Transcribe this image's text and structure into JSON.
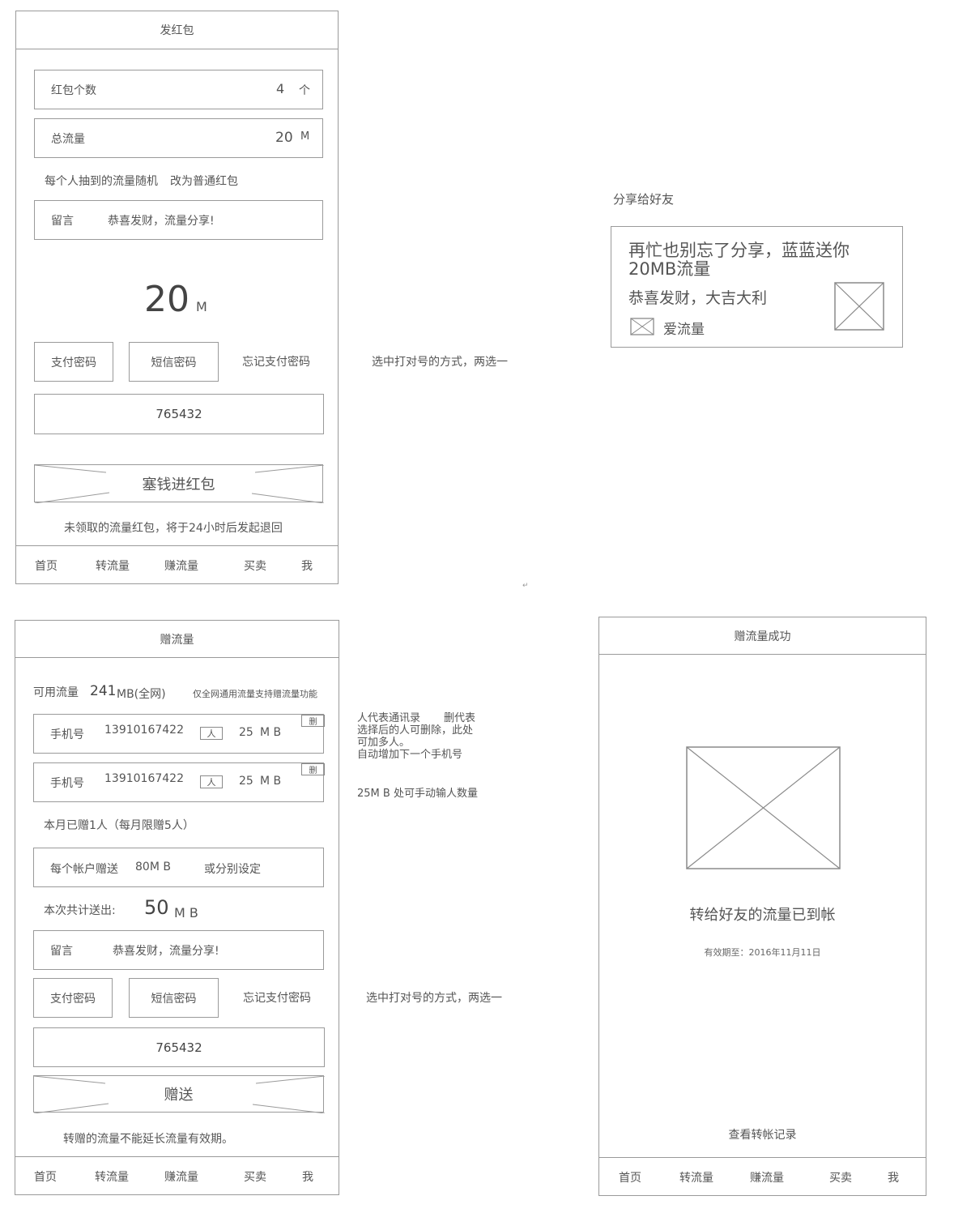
{
  "frame1": {
    "title": "发红包",
    "count_label": "红包个数",
    "count_value": "4",
    "count_unit": "个",
    "total_label": "总流量",
    "total_value": "20",
    "total_unit": "M",
    "random_note": "每个人抽到的流量随机",
    "switch_link": "改为普通红包",
    "msg_label": "留言",
    "msg_value": "恭喜发财，流量分享!",
    "big_amount": "20",
    "big_unit": "M",
    "pay_pwd_btn": "支付密码",
    "sms_pwd_btn": "短信密码",
    "forgot_link": "忘记支付密码",
    "password_value": "765432",
    "submit_btn": "塞钱进红包",
    "footer_note": "未领取的流量红包，将于24小时后发起退回"
  },
  "nav": [
    "首页",
    "转流量",
    "赚流量",
    "买卖",
    "我"
  ],
  "note_pay_choice": "选中打对号的方式，两选一",
  "share": {
    "heading": "分享给好友",
    "title": "再忙也别忘了分享，蓝蓝送你20MB流量",
    "subtitle": "恭喜发财，大吉大利",
    "brand": "爱流量"
  },
  "frame2": {
    "title": "赠流量",
    "avail_label": "可用流量",
    "avail_value": "241",
    "avail_unit": "MB(全网)",
    "avail_note": "仅全网通用流量支持赠流量功能",
    "recipients": [
      {
        "label": "手机号",
        "phone": "13910167422",
        "contact_icon": "人",
        "amount": "25",
        "unit": "M B",
        "delete": "删"
      },
      {
        "label": "手机号",
        "phone": "13910167422",
        "contact_icon": "人",
        "amount": "25",
        "unit": "M B",
        "delete": "删"
      }
    ],
    "month_note": "本月已赠1人（每月限赠5人）",
    "per_account_label": "每个帐户赠送",
    "per_account_value": "80M B",
    "per_account_alt": "或分别设定",
    "total_label": "本次共计送出:",
    "total_value": "50",
    "total_unit": "M B",
    "msg_label": "留言",
    "msg_value": "恭喜发财，流量分享!",
    "pay_pwd_btn": "支付密码",
    "sms_pwd_btn": "短信密码",
    "forgot_link": "忘记支付密码",
    "password_value": "765432",
    "submit_btn": "赠送",
    "footer_note": "转赠的流量不能延长流量有效期。"
  },
  "annotations": {
    "contacts_1": "人代表通讯录",
    "contacts_2": "删代表",
    "contacts_3": "选择后的人可删除，此处",
    "contacts_4": "可加多人。",
    "contacts_5": "自动增加下一个手机号",
    "amount_note": "25M B 处可手动输人数量"
  },
  "frame3": {
    "title": "赠流量成功",
    "message": "转给好友的流量已到帐",
    "expiry": "有效期至：2016年11月11日",
    "history_link": "查看转帐记录"
  },
  "stray_mark": "↵"
}
